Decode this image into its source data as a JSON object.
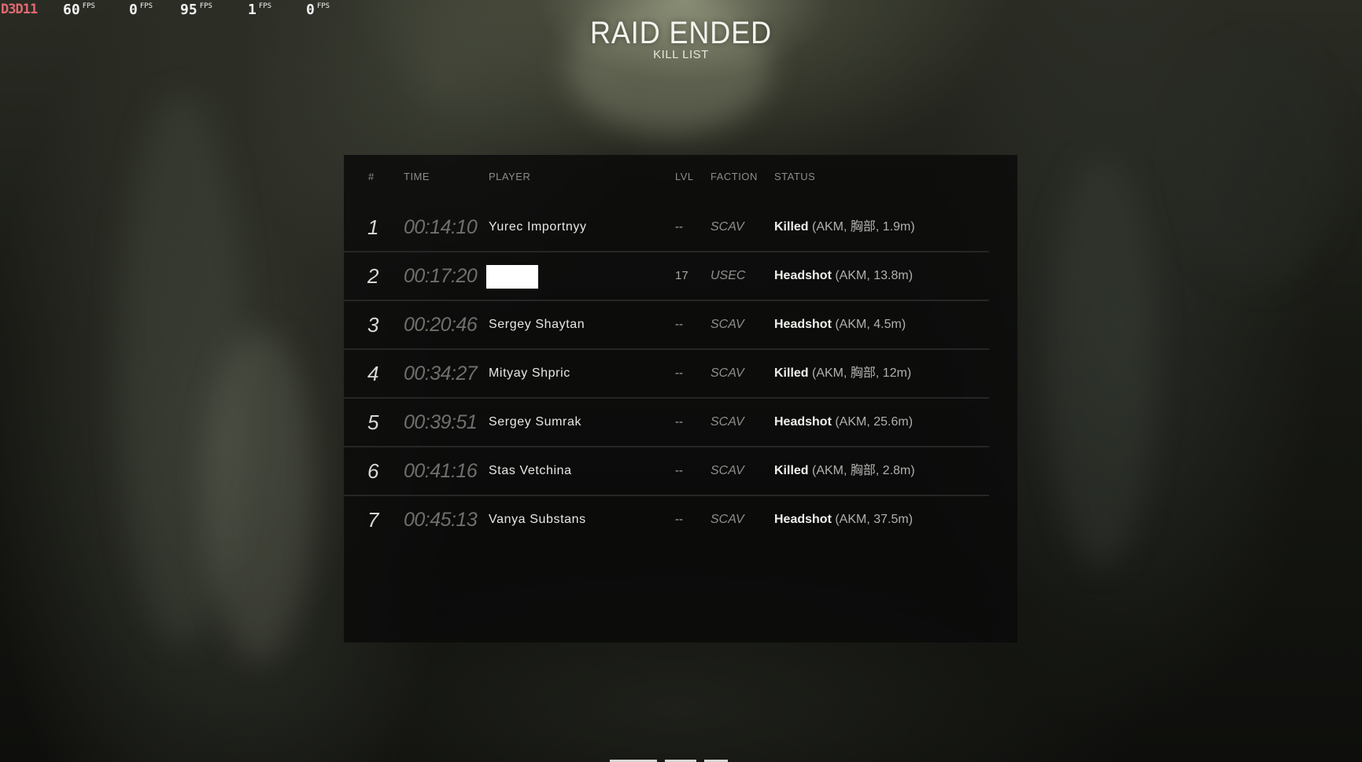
{
  "overlay": {
    "api": "D3D11",
    "fps_unit": "FPS",
    "counters": [
      "60",
      "0",
      "95",
      "1",
      "0"
    ]
  },
  "header": {
    "title": "RAID ENDED",
    "subtitle": "KILL LIST"
  },
  "table": {
    "columns": {
      "num": "#",
      "time": "TIME",
      "player": "PLAYER",
      "lvl": "LVL",
      "faction": "FACTION",
      "status": "STATUS"
    },
    "rows": [
      {
        "num": "1",
        "time": "00:14:10",
        "player": "Yurec Importnyy",
        "redacted": false,
        "lvl": "--",
        "faction": "SCAV",
        "status_type": "Killed",
        "status_detail": " (AKM, 胸部, 1.9m)"
      },
      {
        "num": "2",
        "time": "00:17:20",
        "player": "",
        "redacted": true,
        "lvl": "17",
        "faction": "USEC",
        "status_type": "Headshot",
        "status_detail": " (AKM, 13.8m)"
      },
      {
        "num": "3",
        "time": "00:20:46",
        "player": "Sergey Shaytan",
        "redacted": false,
        "lvl": "--",
        "faction": "SCAV",
        "status_type": "Headshot",
        "status_detail": " (AKM, 4.5m)"
      },
      {
        "num": "4",
        "time": "00:34:27",
        "player": "Mityay Shpric",
        "redacted": false,
        "lvl": "--",
        "faction": "SCAV",
        "status_type": "Killed",
        "status_detail": " (AKM, 胸部, 12m)"
      },
      {
        "num": "5",
        "time": "00:39:51",
        "player": "Sergey Sumrak",
        "redacted": false,
        "lvl": "--",
        "faction": "SCAV",
        "status_type": "Headshot",
        "status_detail": " (AKM, 25.6m)"
      },
      {
        "num": "6",
        "time": "00:41:16",
        "player": "Stas Vetchina",
        "redacted": false,
        "lvl": "--",
        "faction": "SCAV",
        "status_type": "Killed",
        "status_detail": " (AKM, 胸部, 2.8m)"
      },
      {
        "num": "7",
        "time": "00:45:13",
        "player": "Vanya Substans",
        "redacted": false,
        "lvl": "--",
        "faction": "SCAV",
        "status_type": "Headshot",
        "status_detail": " (AKM, 37.5m)"
      }
    ]
  }
}
